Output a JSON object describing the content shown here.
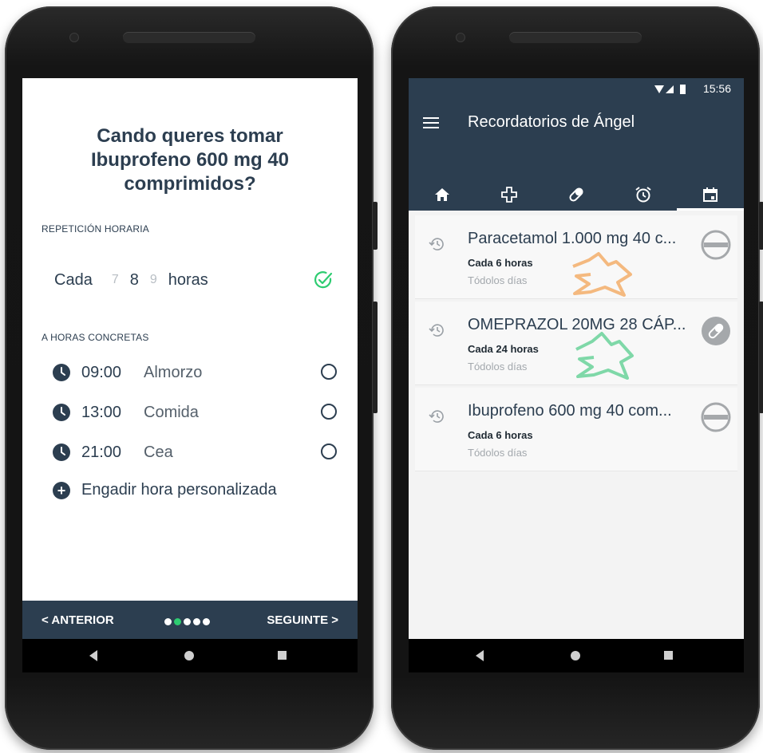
{
  "left": {
    "question": [
      "Cando queres tomar",
      "Ibuprofeno 600 mg 40",
      "comprimidos?"
    ],
    "repetition_label": "REPETICIÓN HORARIA",
    "repetition": {
      "prefix": "Cada",
      "prev": "7",
      "selected": "8",
      "next": "9",
      "suffix": "horas"
    },
    "specific_label": "A HORAS CONCRETAS",
    "times": [
      {
        "time": "09:00",
        "meal": "Almorzo"
      },
      {
        "time": "13:00",
        "meal": "Comida"
      },
      {
        "time": "21:00",
        "meal": "Cea"
      }
    ],
    "add_custom": "Engadir hora personalizada",
    "nav": {
      "prev": "< ANTERIOR",
      "next": "SEGUINTE >",
      "active_dot": 1,
      "dots": 5
    },
    "colors": {
      "primary": "#2c3e50",
      "accent": "#2ecc71"
    }
  },
  "right": {
    "status_time": "15:56",
    "title": "Recordatorios de Ángel",
    "tabs": [
      "home-icon",
      "medical-cross-icon",
      "pill-icon",
      "alarm-icon",
      "calendar-icon"
    ],
    "active_tab": 4,
    "reminders": [
      {
        "name": "Paracetamol 1.000 mg 40 c...",
        "frequency": "Cada 6 horas",
        "days": "Tódolos días",
        "status_icon": "no-entry-icon"
      },
      {
        "name": "OMEPRAZOL 20MG 28 CÁP...",
        "frequency": "Cada 24 horas",
        "days": "Tódolos días",
        "status_icon": "pill-icon"
      },
      {
        "name": "Ibuprofeno 600 mg 40 com...",
        "frequency": "Cada 6 horas",
        "days": "Tódolos días",
        "status_icon": "no-entry-icon"
      }
    ],
    "fab_label": "+"
  }
}
